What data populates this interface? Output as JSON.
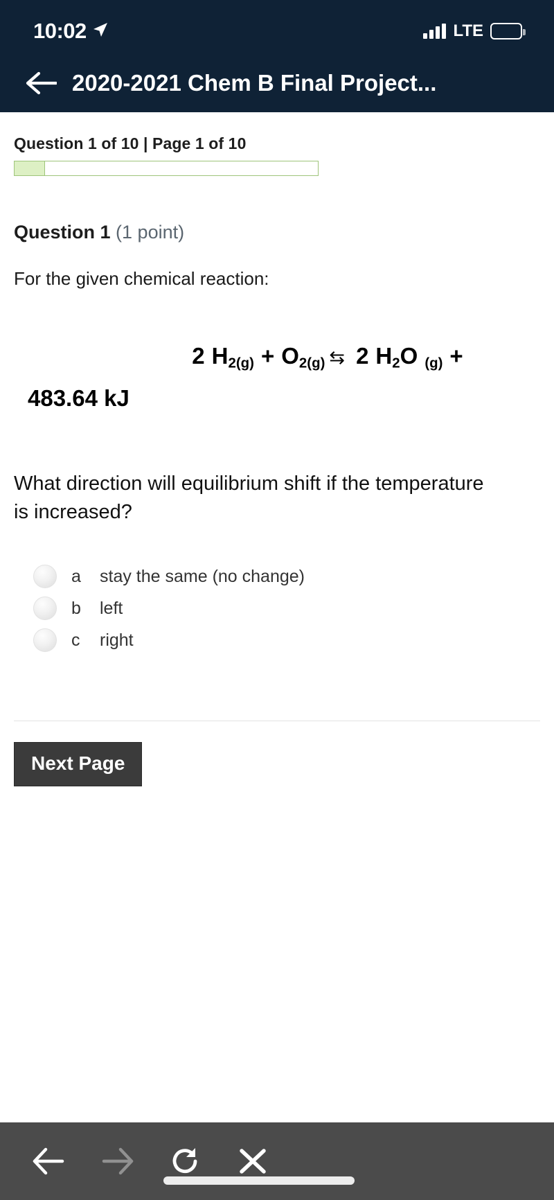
{
  "status_bar": {
    "time": "10:02",
    "location_icon": "location-arrow-icon",
    "signal_icon": "cellular-signal-icon",
    "network": "LTE",
    "battery_icon": "battery-icon"
  },
  "nav": {
    "back_icon": "back-arrow-icon",
    "title": "2020-2021 Chem B Final Project..."
  },
  "quiz": {
    "meta": "Question 1 of 10 | Page 1 of 10",
    "progress_percent": 10,
    "progress_border_color": "#9ec47a",
    "progress_fill_color": "#ddf0c4",
    "question_number": "Question 1",
    "points": "(1 point)",
    "prompt": "For the given chemical reaction:",
    "equation": {
      "coef_h2": "2",
      "h_symbol": "H",
      "h_sub": "2(g)",
      "plus1": "+",
      "o_symbol": "O",
      "o_sub": "2(g)",
      "arrow": "⇆",
      "coef_h2o": "2",
      "h2o_h": "H",
      "h2o_sub2": "2",
      "h2o_o": "O",
      "h2o_state": "(g)",
      "plus2": "+",
      "energy": "483.64 kJ",
      "plain_text": "2 H2(g) + O2(g) ⇆ 2 H2O (g) + 483.64 kJ"
    },
    "question_text": "What direction will equilibrium shift if the temperature is increased?",
    "options": [
      {
        "letter": "a",
        "text": "stay the same (no change)",
        "selected": false
      },
      {
        "letter": "b",
        "text": "left",
        "selected": false
      },
      {
        "letter": "c",
        "text": "right",
        "selected": false
      }
    ],
    "next_button": "Next Page"
  },
  "toolbar": {
    "back_icon": "back-arrow-icon",
    "forward_icon": "forward-arrow-icon",
    "reload_icon": "reload-icon",
    "close_icon": "close-x-icon",
    "home_indicator": "home-indicator"
  }
}
